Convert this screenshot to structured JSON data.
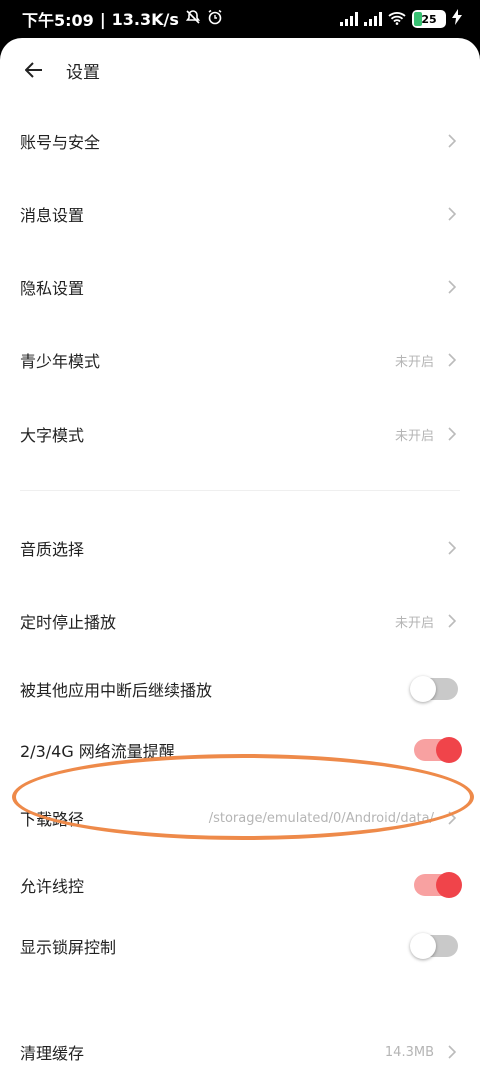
{
  "statusbar": {
    "time": "下午5:09",
    "separator": "|",
    "speed": "13.3K/s",
    "battery": "25"
  },
  "header": {
    "title": "设置"
  },
  "items": [
    {
      "label": "账号与安全",
      "value": ""
    },
    {
      "label": "消息设置",
      "value": ""
    },
    {
      "label": "隐私设置",
      "value": ""
    },
    {
      "label": "青少年模式",
      "value": "未开启"
    },
    {
      "label": "大字模式",
      "value": "未开启"
    },
    {
      "label": "音质选择",
      "value": ""
    },
    {
      "label": "定时停止播放",
      "value": "未开启"
    },
    {
      "label": "被其他应用中断后继续播放",
      "toggle": "off"
    },
    {
      "label": "2/3/4G 网络流量提醒",
      "toggle": "on"
    },
    {
      "label": "下载路径",
      "value": "/storage/emulated/0/Android/data/"
    },
    {
      "label": "允许线控",
      "toggle": "on"
    },
    {
      "label": "显示锁屏控制",
      "toggle": "off"
    },
    {
      "label": "清理缓存",
      "value": "14.3MB"
    }
  ],
  "colors": {
    "accent": "#f0444a",
    "highlight_ring": "#ee8a4a"
  }
}
